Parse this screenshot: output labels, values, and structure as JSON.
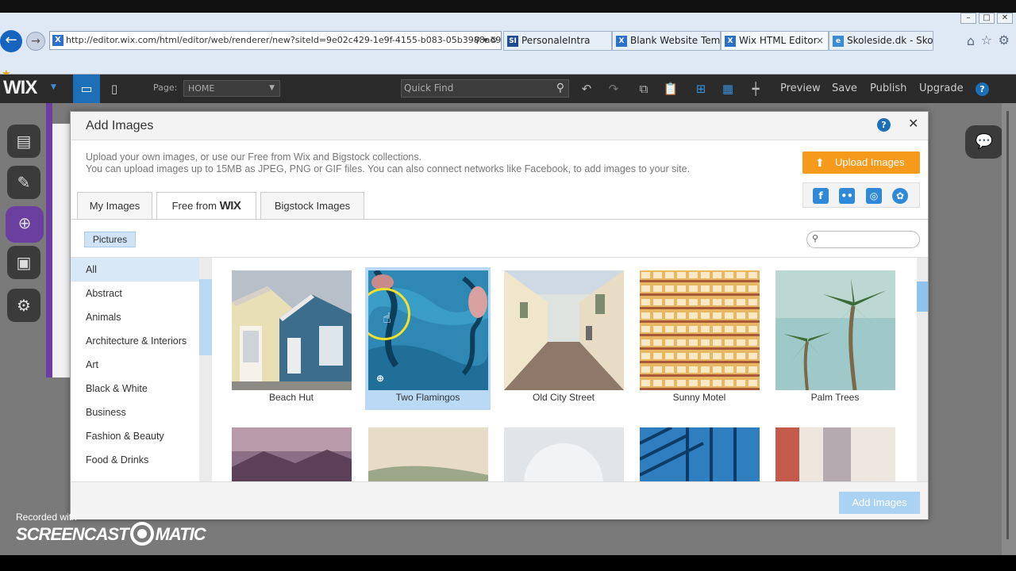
{
  "browser": {
    "address": "http://editor.wix.com/html/editor/web/renderer/new?siteId=9e02c429-1e9f-4155-b083-05b3988ad9",
    "address_tools": "⚲ ▾ ↻",
    "tabs": [
      {
        "label": "PersonaleIntra",
        "favicon": "SI",
        "color": "#1f4d91"
      },
      {
        "label": "Blank Website Tem...",
        "favicon": "X",
        "color": "#2b70c9"
      },
      {
        "label": "Wix HTML Editor",
        "favicon": "X",
        "color": "#2b70c9"
      },
      {
        "label": "Skoleside.dk - Skole...",
        "favicon": "e",
        "color": "#3b8ad8"
      }
    ],
    "tab_close": "×"
  },
  "wixbar": {
    "logo": "WIX",
    "page_label": "Page:",
    "page_value": "HOME",
    "quickfind_placeholder": "Quick Find",
    "menu": [
      "Preview",
      "Save",
      "Publish",
      "Upgrade"
    ],
    "help": "?"
  },
  "dialog": {
    "title": "Add Images",
    "help": "?",
    "close": "✕",
    "desc_line1": "Upload your own images, or use our Free from Wix and Bigstock collections.",
    "desc_line2": "You can upload images up to 15MB as JPEG, PNG or GIF files. You can also connect networks like Facebook, to add images to your site.",
    "upload_label": "Upload Images",
    "social": [
      "f",
      "••",
      "◎",
      "✿"
    ],
    "tabs": {
      "my_images": "My Images",
      "free_from": "Free from",
      "free_brand": "WIX",
      "bigstock": "Bigstock Images"
    },
    "filter": "Pictures",
    "search_placeholder": "",
    "categories": [
      "All",
      "Abstract",
      "Animals",
      "Architecture & Interiors",
      "Art",
      "Black & White",
      "Business",
      "Fashion & Beauty",
      "Food & Drinks"
    ],
    "selected_category": "All",
    "images": [
      {
        "caption": "Beach Hut",
        "selected": false
      },
      {
        "caption": "Two Flamingos",
        "selected": true
      },
      {
        "caption": "Old City Street",
        "selected": false
      },
      {
        "caption": "Sunny Motel",
        "selected": false
      },
      {
        "caption": "Palm Trees",
        "selected": false
      }
    ],
    "add_button": "Add Images"
  },
  "watermark": {
    "line1": "Recorded with",
    "brand_left": "SCREENCAST",
    "brand_right": "MATIC"
  }
}
